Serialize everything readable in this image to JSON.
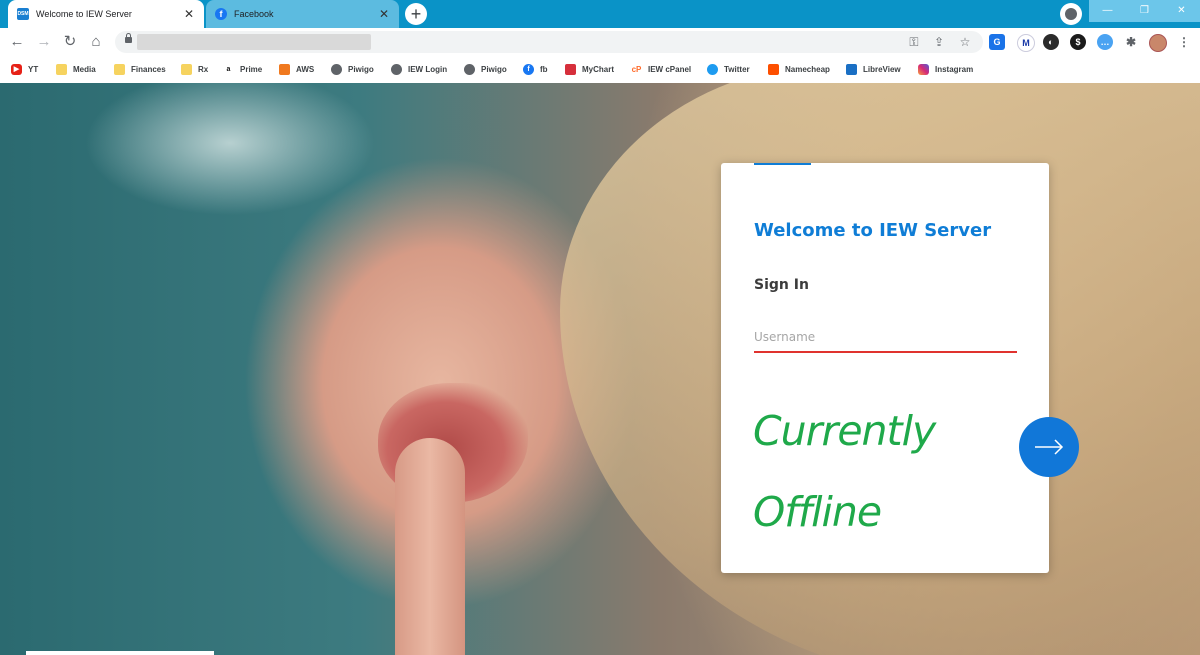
{
  "browser": {
    "tabs": [
      {
        "title": "Welcome to IEW Server",
        "icon": "dsm-icon",
        "icon_text": "DSM",
        "active": true
      },
      {
        "title": "Facebook",
        "icon": "facebook-icon",
        "active": false
      }
    ],
    "new_tab": "+",
    "window_controls": [
      "—",
      "❐",
      "✕"
    ],
    "bookmarks": [
      {
        "label": "YT",
        "icon": "youtube-icon"
      },
      {
        "label": "Media",
        "icon": "folder-icon"
      },
      {
        "label": "Finances",
        "icon": "folder-icon"
      },
      {
        "label": "Rx",
        "icon": "folder-icon"
      },
      {
        "label": "Prime",
        "icon": "amazon-icon"
      },
      {
        "label": "AWS",
        "icon": "aws-icon"
      },
      {
        "label": "Piwigo",
        "icon": "globe-icon"
      },
      {
        "label": "IEW Login",
        "icon": "globe-icon"
      },
      {
        "label": "Piwigo",
        "icon": "globe-icon"
      },
      {
        "label": "fb",
        "icon": "facebook-icon"
      },
      {
        "label": "MyChart",
        "icon": "mychart-icon"
      },
      {
        "label": "IEW cPanel",
        "icon": "cpanel-icon"
      },
      {
        "label": "Twitter",
        "icon": "twitter-icon"
      },
      {
        "label": "Namecheap",
        "icon": "namecheap-icon"
      },
      {
        "label": "LibreView",
        "icon": "libreview-icon"
      },
      {
        "label": "Instagram",
        "icon": "instagram-icon"
      }
    ]
  },
  "login": {
    "title": "Welcome to IEW Server",
    "subtitle": "Sign In",
    "username_placeholder": "Username",
    "status_line1": "Currently",
    "status_line2": "Offline"
  },
  "colors": {
    "tab_strip": "#0a93c7",
    "accent_blue": "#0f7dd6",
    "input_underline": "#e0322e",
    "status_green": "#1fa94a",
    "submit_button": "#1177d8"
  }
}
